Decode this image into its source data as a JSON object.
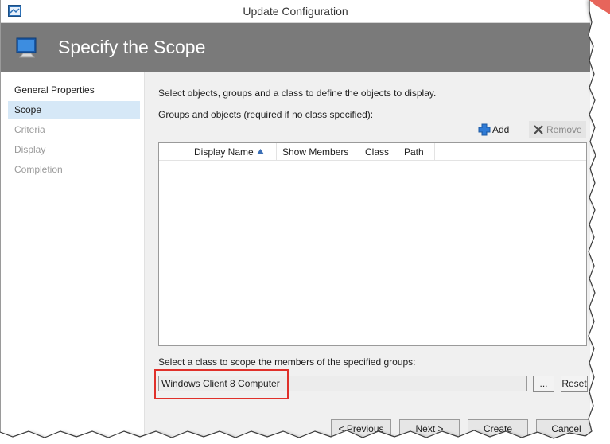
{
  "window": {
    "title": "Update Configuration"
  },
  "header": {
    "title": "Specify the Scope"
  },
  "sidebar": {
    "items": [
      {
        "label": "General Properties",
        "state": "normal"
      },
      {
        "label": "Scope",
        "state": "selected"
      },
      {
        "label": "Criteria",
        "state": "disabled"
      },
      {
        "label": "Display",
        "state": "disabled"
      },
      {
        "label": "Completion",
        "state": "disabled"
      }
    ]
  },
  "main": {
    "instruction": "Select objects, groups and a class to define the objects to display.",
    "groups_label": "Groups and objects (required if no class specified):",
    "toolbar": {
      "add_label": "Add",
      "remove_label": "Remove"
    },
    "grid": {
      "columns": [
        "Display Name",
        "Show Members",
        "Class",
        "Path"
      ],
      "sort_column": "Display Name",
      "sort_direction": "ascending",
      "rows": []
    },
    "class_label": "Select a class to scope the members of the specified groups:",
    "class_value": "Windows Client 8 Computer",
    "browse_label": "...",
    "reset_label": "Reset"
  },
  "footer": {
    "previous_label": "< Previous",
    "next_label": "Next >",
    "create_label": "Create",
    "cancel_label": "Cancel"
  },
  "colors": {
    "header_bg": "#7a7a7a",
    "selected_nav_bg": "#d6e8f7",
    "highlight_border": "#e0302a",
    "add_icon": "#2f7bd6"
  },
  "icons": {
    "app": "window-icon",
    "header": "monitor-icon",
    "add": "plus-icon",
    "remove": "x-icon",
    "sort": "sort-ascending-icon"
  }
}
